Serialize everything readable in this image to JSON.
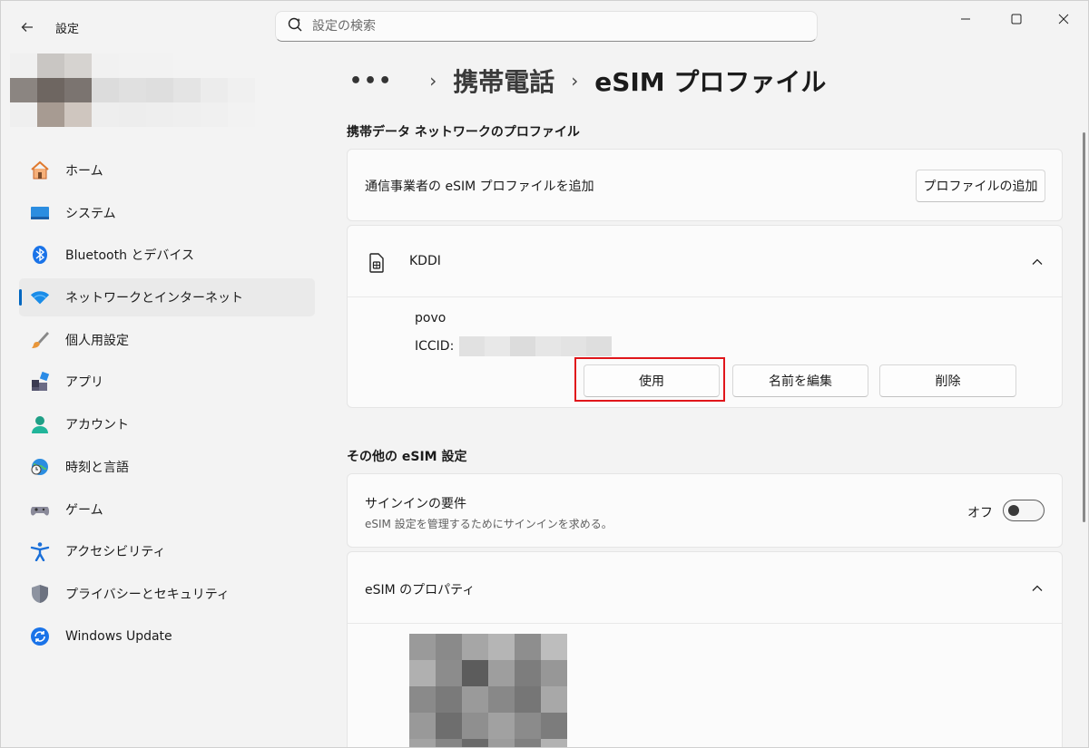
{
  "window": {
    "title": "設定",
    "search_placeholder": "設定の検索"
  },
  "sidebar": {
    "items": [
      {
        "label": "ホーム",
        "icon": "home-icon"
      },
      {
        "label": "システム",
        "icon": "system-icon"
      },
      {
        "label": "Bluetooth とデバイス",
        "icon": "bluetooth-icon"
      },
      {
        "label": "ネットワークとインターネット",
        "icon": "wifi-icon",
        "active": true
      },
      {
        "label": "個人用設定",
        "icon": "brush-icon"
      },
      {
        "label": "アプリ",
        "icon": "apps-icon"
      },
      {
        "label": "アカウント",
        "icon": "account-icon"
      },
      {
        "label": "時刻と言語",
        "icon": "globe-clock-icon"
      },
      {
        "label": "ゲーム",
        "icon": "gamepad-icon"
      },
      {
        "label": "アクセシビリティ",
        "icon": "accessibility-icon"
      },
      {
        "label": "プライバシーとセキュリティ",
        "icon": "shield-icon"
      },
      {
        "label": "Windows Update",
        "icon": "update-icon"
      }
    ]
  },
  "breadcrumb": {
    "dots": "•••",
    "parent": "携帯電話",
    "current": "eSIM プロファイル"
  },
  "sections": {
    "profiles_title": "携帯データ ネットワークのプロファイル",
    "add_profile_text": "通信事業者の eSIM プロファイルを追加",
    "add_profile_button": "プロファイルの追加",
    "carrier_name": "KDDI",
    "profile_name": "povo",
    "iccid_label": "ICCID:",
    "use_button": "使用",
    "rename_button": "名前を編集",
    "delete_button": "削除",
    "other_title": "その他の eSIM 設定",
    "signin_title": "サインインの要件",
    "signin_desc": "eSIM 設定を管理するためにサインインを求める。",
    "signin_state": "オフ",
    "properties_title": "eSIM のプロパティ"
  },
  "colors": {
    "accent": "#0067c0",
    "highlight": "#e0161b"
  }
}
